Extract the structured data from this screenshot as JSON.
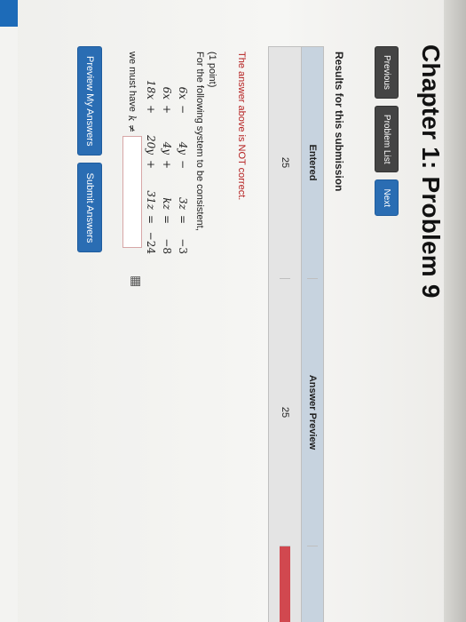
{
  "page_title": "Chapter 1: Problem 9",
  "nav": {
    "previous": "Previous",
    "problem_list": "Problem List",
    "next": "Next"
  },
  "results_heading": "Results for this submission",
  "table": {
    "headers": {
      "entered": "Entered",
      "answer_preview": "Answer Preview"
    },
    "row": {
      "entered": "25",
      "preview": "25"
    }
  },
  "result_message": "The answer above is NOT correct.",
  "problem": {
    "points": "(1 point)",
    "prompt": "For the following system to be consistent,",
    "equations": [
      {
        "a": "6x",
        "op1": "−",
        "b": "4y",
        "op2": "−",
        "c": "3z",
        "eq": "=",
        "rhs": "−3"
      },
      {
        "a": "6x",
        "op1": "+",
        "b": "4y",
        "op2": "+",
        "c": "kz",
        "eq": "=",
        "rhs": "−8"
      },
      {
        "a": "18x",
        "op1": "+",
        "b": "20y",
        "op2": "+",
        "c": "31z",
        "eq": "=",
        "rhs": "−24"
      }
    ],
    "need_text": "we must have",
    "need_var": "k ≠",
    "answer_value": ""
  },
  "actions": {
    "preview": "Preview My Answers",
    "submit": "Submit Answers"
  },
  "icons": {
    "answer_grid": "grid-icon"
  },
  "colors": {
    "accent": "#2a6db3",
    "error": "#b52020",
    "incorrect_cell": "#d1484f",
    "header_bg": "#c7d3df"
  }
}
